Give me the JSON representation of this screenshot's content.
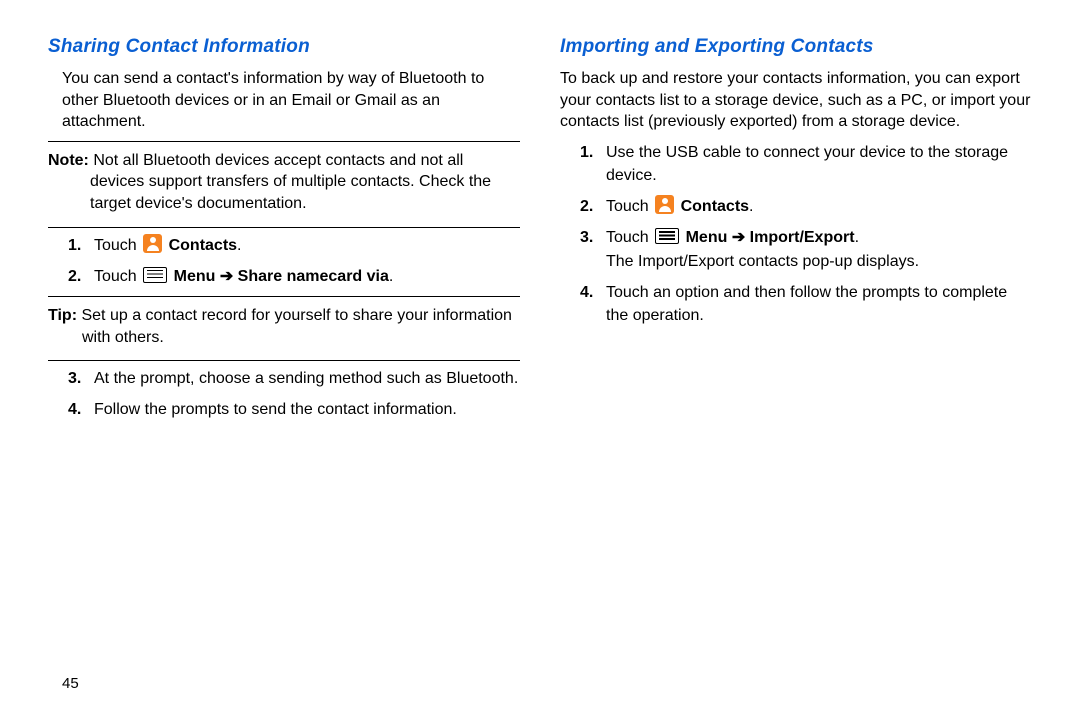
{
  "page_number": "45",
  "left": {
    "title": "Sharing Contact Information",
    "intro": "You can send a contact's information by way of Bluetooth to other Bluetooth devices or in an Email or Gmail as an attachment.",
    "note_label": "Note: ",
    "note_text": "Not all Bluetooth devices accept contacts and not all devices support transfers of multiple contacts. Check the target device's documentation.",
    "step1_pre": "Touch ",
    "step1_bold": " Contacts",
    "step2_pre": "Touch",
    "step2_menu_bold": " Menu ",
    "step2_arrow": "➔",
    "step2_action_bold": " Share namecard via",
    "tip_label": "Tip: ",
    "tip_text": "Set up a contact record for yourself to share your information with others.",
    "step3": "At the prompt, choose a sending method such as Bluetooth.",
    "step4": "Follow the prompts to send the contact information."
  },
  "right": {
    "title": "Importing and Exporting Contacts",
    "intro": "To back up and restore your contacts information, you can export your contacts list to a storage device, such as a PC, or import your contacts list (previously exported) from a storage device.",
    "step1": "Use the USB cable to connect your device to the storage device.",
    "step2_pre": "Touch ",
    "step2_bold": " Contacts",
    "step3_pre": "Touch ",
    "step3_menu_bold": " Menu ",
    "step3_arrow": "➔",
    "step3_action_bold": " Import/Export",
    "step3_sub": "The Import/Export contacts pop-up displays.",
    "step4": "Touch an option and then follow the prompts to complete the operation."
  }
}
